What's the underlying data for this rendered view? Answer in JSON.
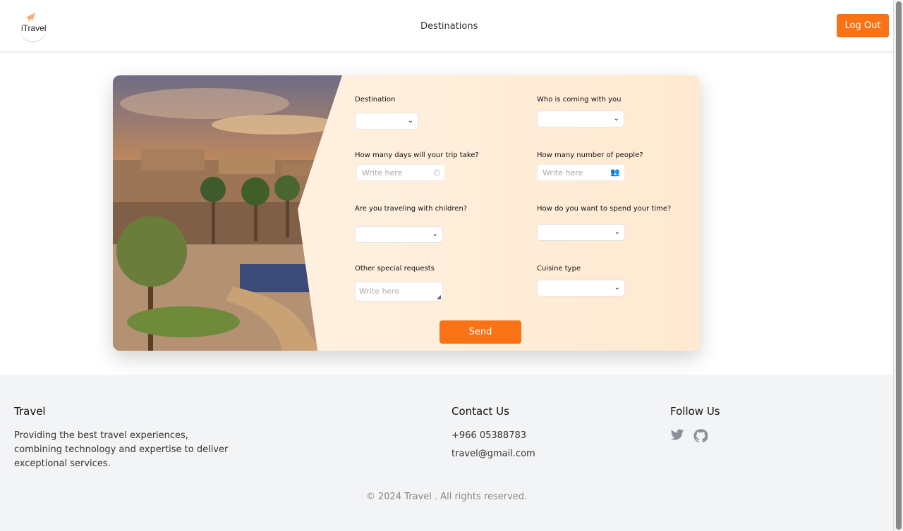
{
  "header": {
    "logo_text": "iTravel",
    "nav_link": "Destinations",
    "logout_label": "Log Out"
  },
  "form": {
    "destination_label": "Destination",
    "companion_label": "Who is coming with you",
    "days_label": "How many days will your trip take?",
    "days_placeholder": "Write here",
    "people_label": "How many number of people?",
    "people_placeholder": "Write here",
    "children_label": "Are you traveling with children?",
    "time_label": "How do you want to spend your time?",
    "requests_label": "Other special requests",
    "requests_placeholder": "Write here",
    "cuisine_label": "Cuisine type",
    "send_label": "Send",
    "icons": {
      "days": "clock-icon",
      "people": "people-icon",
      "select": "chevron-down-icon"
    }
  },
  "footer": {
    "brand_title": "Travel",
    "brand_description": "Providing the best travel experiences, combining technology and expertise to deliver exceptional services.",
    "contact_title": "Contact Us",
    "phone": "+966 05388783",
    "email": "travel@gmail.com",
    "follow_title": "Follow Us",
    "social_icons": [
      "twitter-icon",
      "github-icon"
    ],
    "copyright": "© 2024 Travel . All rights reserved."
  },
  "colors": {
    "accent": "#f97316",
    "form_bg_start": "#fff4e8",
    "form_bg_end": "#ffe9d0",
    "footer_bg": "#f3f4f6"
  }
}
